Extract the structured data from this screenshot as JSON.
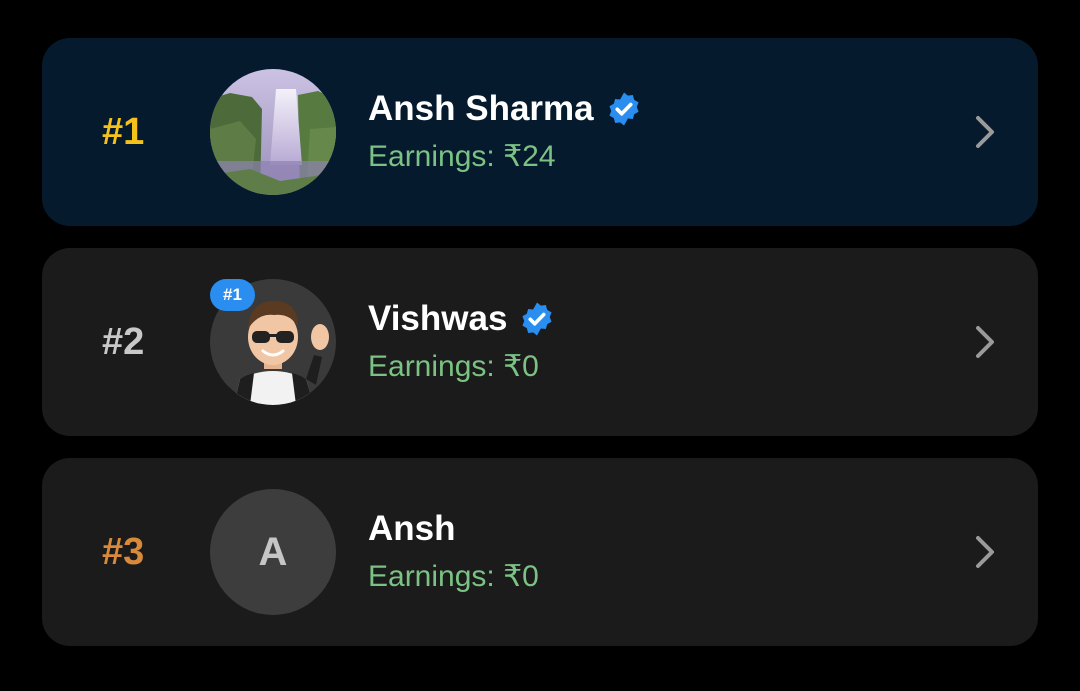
{
  "leaderboard": {
    "entries": [
      {
        "rank": "#1",
        "rank_color": "#f5c21b",
        "name": "Ansh Sharma",
        "verified": true,
        "earnings": "Earnings: ₹24",
        "avatar": "waterfall-photo"
      },
      {
        "rank": "#2",
        "rank_color": "#c8c8c8",
        "name": "Vishwas",
        "verified": true,
        "badge": "#1",
        "earnings": "Earnings: ₹0",
        "avatar": "memoji-waving"
      },
      {
        "rank": "#3",
        "rank_color": "#d8893a",
        "name": "Ansh",
        "verified": false,
        "earnings": "Earnings: ₹0",
        "avatar_initial": "A"
      }
    ]
  },
  "colors": {
    "background": "#000000",
    "card_highlight": "#061a2e",
    "card": "#1b1b1b",
    "earnings": "#7bc284",
    "verified_badge": "#2a8df0"
  },
  "icons": {
    "verified": "verified-badge-icon",
    "chevron": "chevron-right-icon"
  }
}
